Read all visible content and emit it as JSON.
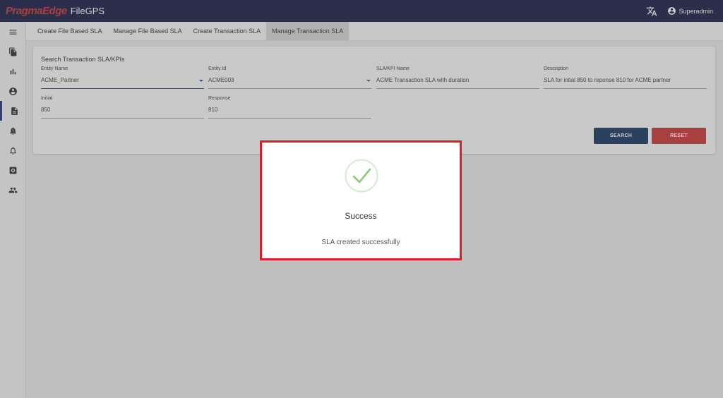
{
  "header": {
    "logo_text": "PragmaEdge",
    "product_name": "FileGPS",
    "user_name": "Superadmin",
    "icons": [
      "translate-icon",
      "account-circle-icon"
    ],
    "colors": {
      "bar": "#0a0f3a",
      "logo": "#d1222b"
    }
  },
  "sidebar": {
    "items": [
      {
        "name": "menu-icon"
      },
      {
        "name": "files-icon"
      },
      {
        "name": "bar-chart-icon"
      },
      {
        "name": "account-icon"
      },
      {
        "name": "document-icon",
        "active": true
      },
      {
        "name": "alert-bell-icon"
      },
      {
        "name": "notification-bell-icon"
      },
      {
        "name": "settings-icon"
      },
      {
        "name": "users-icon"
      }
    ]
  },
  "tabs": [
    {
      "label": "Create File Based SLA"
    },
    {
      "label": "Manage File Based SLA"
    },
    {
      "label": "Create Transaction SLA"
    },
    {
      "label": "Manage Transaction SLA",
      "active": true
    }
  ],
  "search": {
    "title": "Search Transaction SLA/KPIs",
    "fields": {
      "entity_name": {
        "label": "Entity Name",
        "value": "ACME_Partner"
      },
      "entity_id": {
        "label": "Entity Id",
        "value": "ACME003"
      },
      "sla_kpi_name": {
        "label": "SLA/KPI Name",
        "value": "ACME Transaction SLA with duration"
      },
      "description": {
        "label": "Description",
        "value": "SLA for intial 850 to reponse 810 for ACME partner"
      },
      "initial": {
        "label": "Initial",
        "value": "850"
      },
      "response": {
        "label": "Response",
        "value": "810"
      }
    },
    "search_button": "SEARCH",
    "reset_button": "RESET",
    "colors": {
      "search": "#0a2a55",
      "reset": "#c62828"
    }
  },
  "dialog": {
    "title": "Success",
    "message": "SLA created successfully",
    "icon": "check-circle-icon",
    "border_color": "#d91f2c"
  }
}
